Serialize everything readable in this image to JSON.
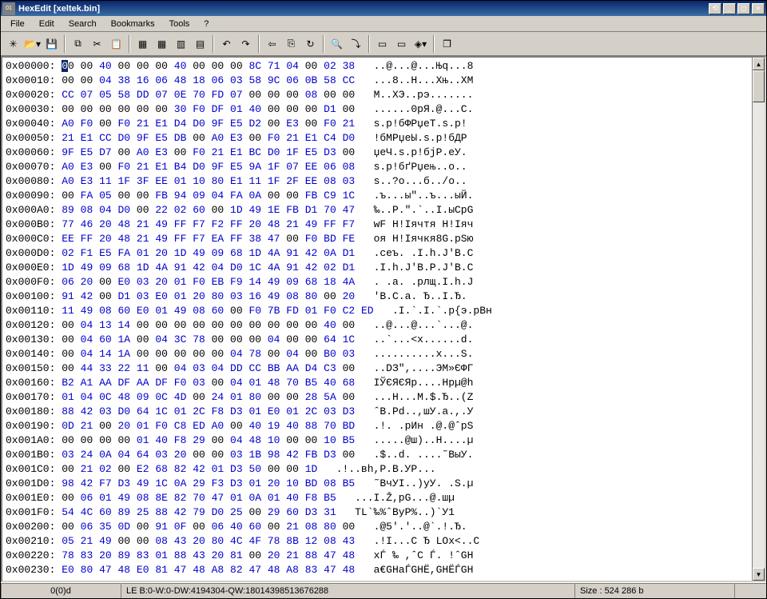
{
  "window": {
    "title": "HexEdit [xeltek.bin]"
  },
  "menu": {
    "items": [
      "File",
      "Edit",
      "Search",
      "Bookmarks",
      "Tools",
      "?"
    ]
  },
  "toolbar": {
    "groups": [
      [
        "sun",
        "open-dd",
        "save"
      ],
      [
        "copy",
        "cut",
        "paste"
      ],
      [
        "grid1",
        "grid2",
        "grid3",
        "grid4"
      ],
      [
        "undo",
        "redo"
      ],
      [
        "arrow-left",
        "insert",
        "rotate"
      ],
      [
        "find",
        "find-next"
      ],
      [
        "ruler",
        "measure",
        "goto-dd"
      ],
      [
        "window-stack"
      ]
    ],
    "glyphs": {
      "sun": "✳",
      "open-dd": "📂▾",
      "save": "💾",
      "copy": "⧉",
      "cut": "✂",
      "paste": "📋",
      "grid1": "▦",
      "grid2": "▦",
      "grid3": "▥",
      "grid4": "▤",
      "undo": "↶",
      "redo": "↷",
      "arrow-left": "⇦",
      "insert": "⎘",
      "rotate": "↻",
      "find": "🔍",
      "find-next": "⤵",
      "ruler": "▭",
      "measure": "▭",
      "goto-dd": "◈▾",
      "window-stack": "❐"
    }
  },
  "status": {
    "position": "0(0)d",
    "info": "LE B:0-W:0-DW:4194304-QW:18014398513676288",
    "size": "Size : 524 286 b",
    "extra": ""
  },
  "rows": [
    {
      "addr": "0x00000",
      "hex": [
        "00",
        "00",
        "40",
        "00",
        "00",
        "00",
        "40",
        "00",
        "00",
        "00",
        "8C",
        "71",
        "04",
        "00",
        "02",
        "38"
      ],
      "ascii": "..@...@...Њq...8"
    },
    {
      "addr": "0x00010",
      "hex": [
        "00",
        "00",
        "04",
        "38",
        "16",
        "06",
        "48",
        "18",
        "06",
        "03",
        "58",
        "9C",
        "06",
        "0B",
        "58",
        "CC"
      ],
      "ascii": "...8..H...Xњ..XМ"
    },
    {
      "addr": "0x00020",
      "hex": [
        "CC",
        "07",
        "05",
        "58",
        "DD",
        "07",
        "0E",
        "70",
        "FD",
        "07",
        "00",
        "00",
        "00",
        "08",
        "00",
        "00"
      ],
      "ascii": "М..XЭ..pэ......."
    },
    {
      "addr": "0x00030",
      "hex": [
        "00",
        "00",
        "00",
        "00",
        "00",
        "00",
        "30",
        "F0",
        "DF",
        "01",
        "40",
        "00",
        "00",
        "00",
        "D1",
        "00"
      ],
      "ascii": "......0рЯ.@...С."
    },
    {
      "addr": "0x00040",
      "hex": [
        "A0",
        "F0",
        "00",
        "F0",
        "21",
        "E1",
        "D4",
        "D0",
        "9F",
        "E5",
        "D2",
        "00",
        "E3",
        "00",
        "F0",
        "21"
      ],
      "ascii": "ѕ.р!бФРџеТ.ѕ.р!"
    },
    {
      "addr": "0x00050",
      "hex": [
        "21",
        "E1",
        "CC",
        "D0",
        "9F",
        "E5",
        "DB",
        "00",
        "A0",
        "E3",
        "00",
        "F0",
        "21",
        "E1",
        "C4",
        "D0"
      ],
      "ascii": "!бМРџеЫ.ѕ.р!бДР"
    },
    {
      "addr": "0x00060",
      "hex": [
        "9F",
        "E5",
        "D7",
        "00",
        "A0",
        "E3",
        "00",
        "F0",
        "21",
        "E1",
        "BC",
        "D0",
        "1F",
        "E5",
        "D3",
        "00"
      ],
      "ascii": "џеЧ.ѕ.р!бјР.еУ."
    },
    {
      "addr": "0x00070",
      "hex": [
        "A0",
        "E3",
        "00",
        "F0",
        "21",
        "E1",
        "B4",
        "D0",
        "9F",
        "E5",
        "9A",
        "1F",
        "07",
        "EE",
        "06",
        "08"
      ],
      "ascii": "ѕ.р!бґРџењ..о.."
    },
    {
      "addr": "0x00080",
      "hex": [
        "A0",
        "E3",
        "11",
        "1F",
        "3F",
        "EE",
        "01",
        "10",
        "80",
        "E1",
        "11",
        "1F",
        "2F",
        "EE",
        "08",
        "03"
      ],
      "ascii": "ѕ..?о...б../о.."
    },
    {
      "addr": "0x00090",
      "hex": [
        "00",
        "FA",
        "05",
        "00",
        "00",
        "FB",
        "94",
        "09",
        "04",
        "FA",
        "0A",
        "00",
        "00",
        "FB",
        "C9",
        "1C"
      ],
      "ascii": ".ъ...ы\"..ъ...ыЙ."
    },
    {
      "addr": "0x000A0",
      "hex": [
        "89",
        "08",
        "04",
        "D0",
        "00",
        "22",
        "02",
        "60",
        "00",
        "1D",
        "49",
        "1E",
        "FB",
        "D1",
        "70",
        "47"
      ],
      "ascii": "‰..Р.\".`..I.ыСpG"
    },
    {
      "addr": "0x000B0",
      "hex": [
        "77",
        "46",
        "20",
        "48",
        "21",
        "49",
        "FF",
        "F7",
        "F2",
        "FF",
        "20",
        "48",
        "21",
        "49",
        "FF",
        "F7"
      ],
      "ascii": "wF H!Iячтя H!Iяч"
    },
    {
      "addr": "0x000C0",
      "hex": [
        "EE",
        "FF",
        "20",
        "48",
        "21",
        "49",
        "FF",
        "F7",
        "EA",
        "FF",
        "38",
        "47",
        "00",
        "F0",
        "BD",
        "FE"
      ],
      "ascii": "оя H!Iячкя8G.рЅю"
    },
    {
      "addr": "0x000D0",
      "hex": [
        "02",
        "F1",
        "E5",
        "FA",
        "01",
        "20",
        "1D",
        "49",
        "09",
        "68",
        "1D",
        "4A",
        "91",
        "42",
        "0A",
        "D1"
      ],
      "ascii": ".сеъ. .I.h.J'B.С"
    },
    {
      "addr": "0x000E0",
      "hex": [
        "1D",
        "49",
        "09",
        "68",
        "1D",
        "4A",
        "91",
        "42",
        "04",
        "D0",
        "1C",
        "4A",
        "91",
        "42",
        "02",
        "D1"
      ],
      "ascii": ".I.h.J'B.Р.J'B.С"
    },
    {
      "addr": "0x000F0",
      "hex": [
        "06",
        "20",
        "00",
        "E0",
        "03",
        "20",
        "01",
        "F0",
        "EB",
        "F9",
        "14",
        "49",
        "09",
        "68",
        "18",
        "4A"
      ],
      "ascii": ". .а. .рлщ.I.h.J"
    },
    {
      "addr": "0x00100",
      "hex": [
        "91",
        "42",
        "00",
        "D1",
        "03",
        "E0",
        "01",
        "20",
        "80",
        "03",
        "16",
        "49",
        "08",
        "80",
        "00",
        "20"
      ],
      "ascii": "'B.С.а. Ђ..I.Ђ. "
    },
    {
      "addr": "0x00110",
      "hex": [
        "11",
        "49",
        "08",
        "60",
        "E0",
        "01",
        "49",
        "08",
        "60",
        "00",
        "F0",
        "7B",
        "FD",
        "01",
        "F0",
        "C2",
        "ED"
      ],
      "ascii": ".I.`.I.`.р{э.рВн"
    },
    {
      "addr": "0x00120",
      "hex": [
        "00",
        "04",
        "13",
        "14",
        "00",
        "00",
        "00",
        "00",
        "00",
        "00",
        "00",
        "00",
        "00",
        "00",
        "40",
        "00"
      ],
      "ascii": "..@...@...`...@."
    },
    {
      "addr": "0x00130",
      "hex": [
        "00",
        "04",
        "60",
        "1A",
        "00",
        "04",
        "3C",
        "78",
        "00",
        "00",
        "00",
        "04",
        "00",
        "00",
        "64",
        "1C"
      ],
      "ascii": "..`...<x......d."
    },
    {
      "addr": "0x00140",
      "hex": [
        "00",
        "04",
        "14",
        "1A",
        "00",
        "00",
        "00",
        "00",
        "00",
        "04",
        "78",
        "00",
        "04",
        "00",
        "B0",
        "03"
      ],
      "ascii": "..........x...Ѕ."
    },
    {
      "addr": "0x00150",
      "hex": [
        "00",
        "44",
        "33",
        "22",
        "11",
        "00",
        "04",
        "03",
        "04",
        "DD",
        "CC",
        "BB",
        "AA",
        "D4",
        "C3",
        "00"
      ],
      "ascii": "..DЗ\",....ЭМ»ЄФГ"
    },
    {
      "addr": "0x00160",
      "hex": [
        "B2",
        "A1",
        "AA",
        "DF",
        "AA",
        "DF",
        "F0",
        "03",
        "00",
        "04",
        "01",
        "48",
        "70",
        "B5",
        "40",
        "68"
      ],
      "ascii": "ІЎЄЯЄЯр....Hpµ@h"
    },
    {
      "addr": "0x00170",
      "hex": [
        "01",
        "04",
        "0C",
        "48",
        "09",
        "0C",
        "4D",
        "00",
        "24",
        "01",
        "80",
        "00",
        "00",
        "28",
        "5A",
        "00"
      ],
      "ascii": "...H...M.$.Ђ..(Z"
    },
    {
      "addr": "0x00180",
      "hex": [
        "88",
        "42",
        "03",
        "D0",
        "64",
        "1C",
        "01",
        "2C",
        "F8",
        "D3",
        "01",
        "E0",
        "01",
        "2C",
        "03",
        "D3"
      ],
      "ascii": "ˆB.Рd..,шУ.а.,.У"
    },
    {
      "addr": "0x00190",
      "hex": [
        "0D",
        "21",
        "00",
        "20",
        "01",
        "F0",
        "C8",
        "ED",
        "A0",
        "00",
        "40",
        "19",
        "40",
        "88",
        "70",
        "BD"
      ],
      "ascii": ".!. .рИн .@.@ˆpЅ"
    },
    {
      "addr": "0x001A0",
      "hex": [
        "00",
        "00",
        "00",
        "00",
        "01",
        "40",
        "F8",
        "29",
        "00",
        "04",
        "48",
        "10",
        "00",
        "00",
        "10",
        "B5"
      ],
      "ascii": ".....@ш)..H....µ"
    },
    {
      "addr": "0x001B0",
      "hex": [
        "03",
        "24",
        "0A",
        "04",
        "64",
        "03",
        "20",
        "00",
        "00",
        "03",
        "1B",
        "98",
        "42",
        "FB",
        "D3",
        "00"
      ],
      "ascii": ".$..d. ....˜BыУ."
    },
    {
      "addr": "0x001C0",
      "hex": [
        "00",
        "21",
        "02",
        "00",
        "E2",
        "68",
        "82",
        "42",
        "01",
        "D3",
        "50",
        "00",
        "00",
        "1D"
      ],
      "ascii": ".!..вh,Р.B.УP..."
    },
    {
      "addr": "0x001D0",
      "hex": [
        "98",
        "42",
        "F7",
        "D3",
        "49",
        "1C",
        "0A",
        "29",
        "F3",
        "D3",
        "01",
        "20",
        "10",
        "BD",
        "08",
        "B5"
      ],
      "ascii": "˜BчУI..)уУ. .Ѕ.µ"
    },
    {
      "addr": "0x001E0",
      "hex": [
        "00",
        "06",
        "01",
        "49",
        "08",
        "8E",
        "82",
        "70",
        "47",
        "01",
        "0A",
        "01",
        "40",
        "F8",
        "B5"
      ],
      "ascii": "...I.Ž,pG...@.шµ"
    },
    {
      "addr": "0x001F0",
      "hex": [
        "54",
        "4C",
        "60",
        "89",
        "25",
        "88",
        "42",
        "79",
        "D0",
        "25",
        "00",
        "29",
        "60",
        "D3",
        "31"
      ],
      "ascii": "TL`‰%ˆByР%..)`У1"
    },
    {
      "addr": "0x00200",
      "hex": [
        "00",
        "06",
        "35",
        "0D",
        "00",
        "91",
        "0F",
        "00",
        "06",
        "40",
        "60",
        "00",
        "21",
        "08",
        "80",
        "00"
      ],
      "ascii": ".@5'.'..@`.!.Ђ."
    },
    {
      "addr": "0x00210",
      "hex": [
        "05",
        "21",
        "49",
        "00",
        "00",
        "08",
        "43",
        "20",
        "80",
        "4C",
        "4F",
        "78",
        "8B",
        "12",
        "08",
        "43"
      ],
      "ascii": ".!I...C Ђ LOx<..C"
    },
    {
      "addr": "0x00220",
      "hex": [
        "78",
        "83",
        "20",
        "89",
        "83",
        "01",
        "88",
        "43",
        "20",
        "81",
        "00",
        "20",
        "21",
        "88",
        "47",
        "48"
      ],
      "ascii": "xЃ ‰ ,ˆC Ѓ. !ˆGH"
    },
    {
      "addr": "0x00230",
      "hex": [
        "E0",
        "80",
        "47",
        "48",
        "E0",
        "81",
        "47",
        "48",
        "A8",
        "82",
        "47",
        "48",
        "A8",
        "83",
        "47",
        "48"
      ],
      "ascii": "а€GHаЃGHЁ,GHЁЃGH"
    }
  ]
}
